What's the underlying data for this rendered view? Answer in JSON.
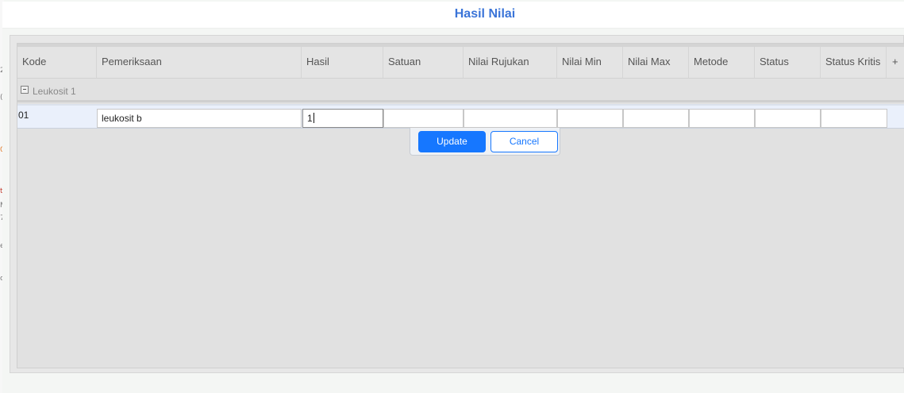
{
  "dialog": {
    "title": "Hasil Nilai"
  },
  "grid": {
    "columns": [
      "Kode",
      "Pemeriksaan",
      "Hasil",
      "Satuan",
      "Nilai Rujukan",
      "Nilai Min",
      "Nilai Max",
      "Metode",
      "Status",
      "Status Kritis",
      "+"
    ],
    "group": {
      "label": "Leukosit 1",
      "expanded": true
    },
    "edit_row": {
      "kode": "01",
      "pemeriksaan": "leukosit b",
      "hasil": "1",
      "satuan": "",
      "nilai_rujukan": "",
      "nilai_min": "",
      "nilai_max": "",
      "metode": "",
      "status": "",
      "status_kritis": ""
    }
  },
  "actions": {
    "update_label": "Update",
    "cancel_label": "Cancel"
  },
  "theme": {
    "accent": "#1677ff",
    "title_color": "#3a74d8"
  },
  "left_strip_glyphs": [
    "2",
    "(",
    "0",
    "t",
    "M",
    "7",
    "e",
    "c"
  ]
}
